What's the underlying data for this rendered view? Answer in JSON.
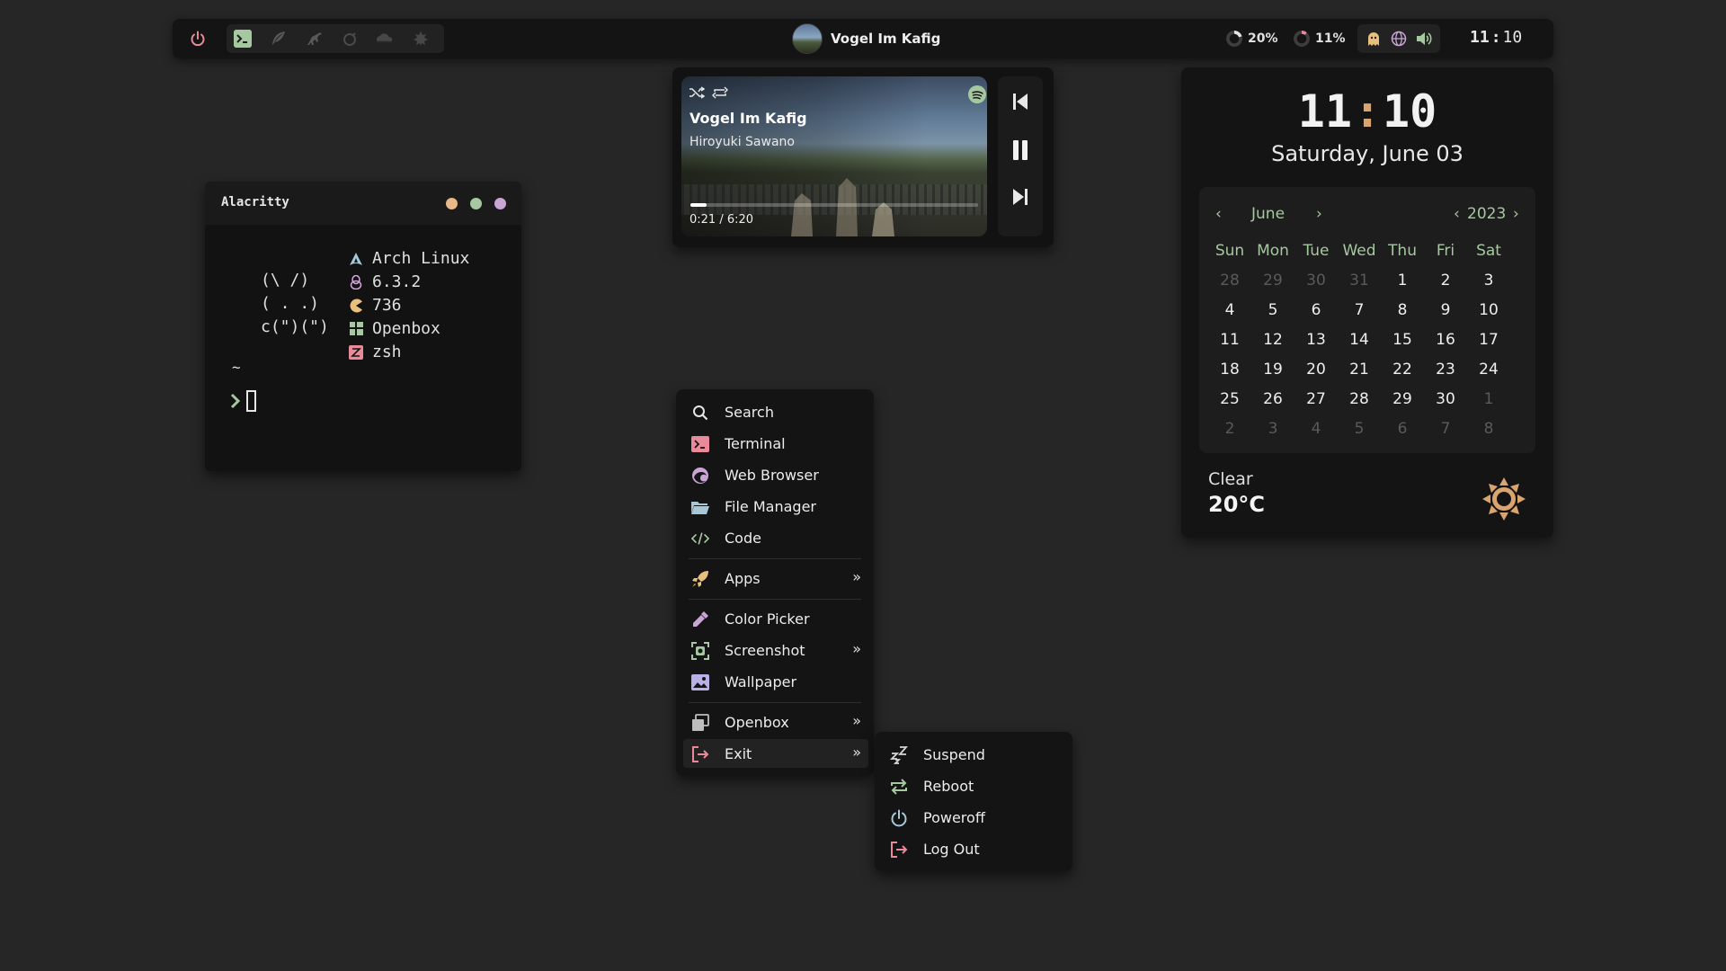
{
  "topbar": {
    "workspace_icons": [
      "terminal-icon",
      "feather-icon",
      "dinosaur-icon",
      "bomb-icon",
      "cloud-icon",
      "leaf-icon"
    ],
    "now_playing": "Vogel Im Kafig",
    "cpu": "20%",
    "mem": "11%",
    "clock_hour": "11",
    "clock_sep": ":",
    "clock_min": "10"
  },
  "terminal": {
    "title": "Alacritty",
    "ascii": [
      "(\\ /)",
      "( . .)",
      "c(\")(\")"
    ],
    "fetch": [
      {
        "icon": "arch-icon",
        "value": "Arch Linux"
      },
      {
        "icon": "linux-tux-icon",
        "value": "6.3.2"
      },
      {
        "icon": "pacman-icon",
        "value": "736"
      },
      {
        "icon": "window-manager-icon",
        "value": "Openbox"
      },
      {
        "icon": "shell-icon",
        "value": "zsh"
      }
    ],
    "cwd": "~"
  },
  "player": {
    "title": "Vogel Im Kafig",
    "artist": "Hiroyuki Sawano",
    "time": "0:21 / 6:20",
    "progress": 0.055
  },
  "clock": {
    "hour": "11",
    "sep": ":",
    "min": "10",
    "date": "Saturday, June 03"
  },
  "calendar": {
    "prev": "‹",
    "month": "June",
    "next": "›",
    "year_prev": "‹",
    "year": "2023",
    "year_next": "›",
    "weekdays": [
      "Sun",
      "Mon",
      "Tue",
      "Wed",
      "Thu",
      "Fri",
      "Sat"
    ],
    "weeks": [
      [
        "28",
        "29",
        "30",
        "31",
        "1",
        "2",
        "3"
      ],
      [
        "4",
        "5",
        "6",
        "7",
        "8",
        "9",
        "10"
      ],
      [
        "11",
        "12",
        "13",
        "14",
        "15",
        "16",
        "17"
      ],
      [
        "18",
        "19",
        "20",
        "21",
        "22",
        "23",
        "24"
      ],
      [
        "25",
        "26",
        "27",
        "28",
        "29",
        "30",
        "1"
      ],
      [
        "2",
        "3",
        "4",
        "5",
        "6",
        "7",
        "8"
      ]
    ],
    "dim_before": 4,
    "dim_after_index": 34
  },
  "weather": {
    "condition": "Clear",
    "temp": "20°C"
  },
  "menu": {
    "items": [
      {
        "label": "Search",
        "icon": "search-icon",
        "submenu": false
      },
      {
        "label": "Terminal",
        "icon": "terminal-icon",
        "submenu": false
      },
      {
        "label": "Web Browser",
        "icon": "browser-icon",
        "submenu": false
      },
      {
        "label": "File Manager",
        "icon": "folder-icon",
        "submenu": false
      },
      {
        "label": "Code",
        "icon": "code-icon",
        "submenu": false
      },
      {
        "label": "Apps",
        "icon": "rocket-icon",
        "submenu": true
      },
      {
        "label": "Color Picker",
        "icon": "eyedropper-icon",
        "submenu": false
      },
      {
        "label": "Screenshot",
        "icon": "screenshot-icon",
        "submenu": true
      },
      {
        "label": "Wallpaper",
        "icon": "image-icon",
        "submenu": false
      },
      {
        "label": "Openbox",
        "icon": "openbox-icon",
        "submenu": true
      },
      {
        "label": "Exit",
        "icon": "exit-icon",
        "submenu": true
      }
    ],
    "arrow": "»"
  },
  "exit_menu": {
    "items": [
      {
        "label": "Suspend",
        "icon": "sleep-icon"
      },
      {
        "label": "Reboot",
        "icon": "reboot-icon"
      },
      {
        "label": "Poweroff",
        "icon": "power-icon"
      },
      {
        "label": "Log Out",
        "icon": "logout-icon"
      }
    ]
  },
  "colors": {
    "background": "#262626",
    "panel": "#141414",
    "green": "#a6c8a0",
    "pink": "#e98a9a",
    "peach": "#d9a46f",
    "purple": "#c9a5d6"
  }
}
